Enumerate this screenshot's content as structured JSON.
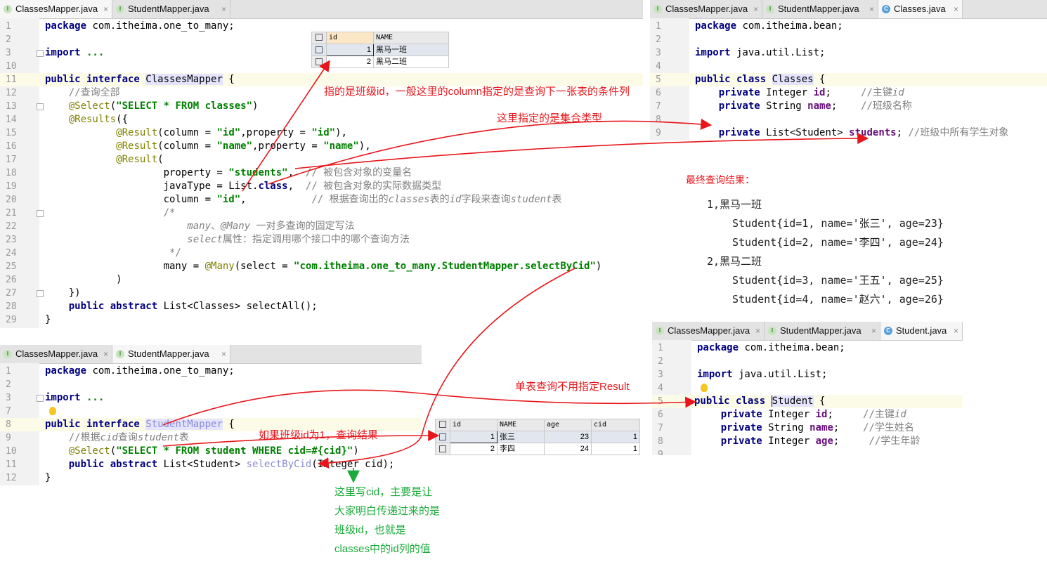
{
  "tabs_tl": [
    {
      "name": "ClassesMapper.java",
      "icon": "I",
      "active": true
    },
    {
      "name": "StudentMapper.java",
      "icon": "I",
      "active": false
    }
  ],
  "tabs_tr": [
    {
      "name": "ClassesMapper.java",
      "icon": "I",
      "active": false
    },
    {
      "name": "StudentMapper.java",
      "icon": "I",
      "active": false
    },
    {
      "name": "Classes.java",
      "icon": "C",
      "active": true
    }
  ],
  "tabs_bl": [
    {
      "name": "ClassesMapper.java",
      "icon": "I",
      "active": false
    },
    {
      "name": "StudentMapper.java",
      "icon": "I",
      "active": true
    }
  ],
  "tabs_br": [
    {
      "name": "ClassesMapper.java",
      "icon": "I",
      "active": false
    },
    {
      "name": "StudentMapper.java",
      "icon": "I",
      "active": false
    },
    {
      "name": "Student.java",
      "icon": "C",
      "active": true
    }
  ],
  "close_glyph": "×",
  "classes_mapper": {
    "numbers": [
      "1",
      "2",
      "3",
      "10",
      "11",
      "12",
      "13",
      "14",
      "15",
      "16",
      "17",
      "18",
      "19",
      "20",
      "21",
      "22",
      "23",
      "24",
      "25",
      "26",
      "27",
      "28",
      "29"
    ],
    "pkg_kw": "package",
    "pkg": " com.itheima.one_to_many;",
    "import_kw": "import",
    "import_rest": " ...",
    "pub": "public",
    "iface": " interface ",
    "cls": "ClassesMapper",
    "brace": " {",
    "c_all": "//查询全部",
    "select_ann": "@Select",
    "select_open": "(",
    "select_sql": "\"SELECT * FROM classes\"",
    "select_close": ")",
    "results_ann": "@Results",
    "results_open": "({",
    "r1_ann": "@Result",
    "r1_a": "(column = ",
    "r1_s1": "\"id\"",
    "r1_b": ",property = ",
    "r1_s2": "\"id\"",
    "r1_c": "),",
    "r2_ann": "@Result",
    "r2_a": "(column = ",
    "r2_s1": "\"name\"",
    "r2_b": ",property = ",
    "r2_s2": "\"name\"",
    "r2_c": "),",
    "r3_ann": "@Result",
    "r3_a": "(",
    "p_prop": "property = ",
    "p_val": "\"students\"",
    "p_comma": ",  ",
    "p_cm": "// 被包含对象的变量名",
    "j_a": "javaType = List.",
    "j_kw": "class",
    "j_b": ",  ",
    "j_cm": "// 被包含对象的实际数据类型",
    "col_a": "column = ",
    "col_val": "\"id\"",
    "col_b": ",           ",
    "col_cm1": "// 根据查询出的",
    "col_cm2": "classes",
    "col_cm3": "表的",
    "col_cm4": "id",
    "col_cm5": "字段来查询",
    "col_cm6": "student",
    "col_cm7": "表",
    "bc_open": "/*",
    "bc1_i": "many",
    "bc1_n": "、",
    "bc1_i2": "@Many",
    "bc1_rest": " 一对多查询的固定写法",
    "bc2_i": "select",
    "bc2_rest": "属性：指定调用哪个接口中的哪个查询方法",
    "bc_close": " */",
    "many_a": "many = ",
    "many_ann": "@Many",
    "many_b": "(select = ",
    "many_str": "\"com.itheima.one_to_many.StudentMapper.selectByCid\"",
    "many_c": ")",
    "paren_close": ")",
    "close2": "})",
    "abs1": "public abstract",
    "abs_rest": " List<Classes> selectAll();",
    "end": "}"
  },
  "classes_table": {
    "headers": [
      "id",
      "NAME"
    ],
    "rows": [
      [
        "1",
        "黑马一班"
      ],
      [
        "2",
        "黑马二班"
      ]
    ]
  },
  "classes_bean": {
    "numbers": [
      "1",
      "2",
      "3",
      "4",
      "5",
      "6",
      "7",
      "8",
      "9"
    ],
    "pkg_kw": "package",
    "pkg": " com.itheima.bean;",
    "import_kw": "import",
    "import_rest": " java.util.List;",
    "pub": "public class",
    "cls": "Classes",
    "brace": " {",
    "f1_kw": "private",
    "f1_t": " Integer ",
    "f1_n": "id",
    "f1_e": ";     ",
    "f1_c": "//主键",
    "f1_ci": "id",
    "f2_kw": "private",
    "f2_t": " String ",
    "f2_n": "name",
    "f2_e": ";    ",
    "f2_c": "//班级名称",
    "f3_kw": "private",
    "f3_t": " List<Student> ",
    "f3_n": "students",
    "f3_e": "; ",
    "f3_c": "//班级中所有学生对象"
  },
  "student_mapper": {
    "numbers": [
      "1",
      "2",
      "3",
      "7",
      "8",
      "9",
      "10",
      "11",
      "12"
    ],
    "pkg_kw": "package",
    "pkg": " com.itheima.one_to_many;",
    "import_kw": "import",
    "import_rest": " ...",
    "pub": "public",
    "iface": " interface ",
    "cls": "StudentMapper",
    "brace": " {",
    "c1": "//根据",
    "c2": "cid",
    "c3": "查询",
    "c4": "student",
    "c5": "表",
    "sel_ann": "@Select",
    "sel_open": "(",
    "sel_sql": "\"SELECT * FROM student WHERE cid=#{cid}\"",
    "sel_close": ")",
    "abs": "public abstract",
    "abs_a": " List<Student> ",
    "abs_m": "selectByCid",
    "abs_b": "(Integer cid);",
    "end": "}"
  },
  "student_table": {
    "headers": [
      "id",
      "NAME",
      "age",
      "cid"
    ],
    "rows": [
      [
        "1",
        "张三",
        "23",
        "1"
      ],
      [
        "2",
        "李四",
        "24",
        "1"
      ]
    ]
  },
  "student_bean": {
    "numbers": [
      "1",
      "2",
      "3",
      "4",
      "5",
      "6",
      "7",
      "8",
      "9"
    ],
    "pkg_kw": "package",
    "pkg": " com.itheima.bean;",
    "import_kw": "import",
    "import_rest": " java.util.List;",
    "pub": "public class",
    "cls": "Student",
    "brace": " {",
    "f1_kw": "private",
    "f1_t": " Integer ",
    "f1_n": "id",
    "f1_e": ";     ",
    "f1_c": "//主键",
    "f1_ci": "id",
    "f2_kw": "private",
    "f2_t": " String ",
    "f2_n": "name",
    "f2_e": ";    ",
    "f2_c": "//学生姓名",
    "f3_kw": "private",
    "f3_t": " Integer ",
    "f3_n": "age",
    "f3_e": ";     ",
    "f3_c": "//学生年龄"
  },
  "notes": {
    "n1": "指的是班级id，一般这里的column指定的是查询下一张表的条件列",
    "n2": "这里指定的是集合类型",
    "n3": "单表查询不用指定Result",
    "n4": "如果班级id为1，查询结果",
    "final_title": "最终查询结果：",
    "g1": "这里写cid，主要是让",
    "g2": "大家明白传递过来的是",
    "g3": "班级id，也就是",
    "g4": "classes中的id列的值"
  },
  "results": {
    "c1": "1,黑马一班",
    "s1": "Student{id=1, name='张三', age=23}",
    "s2": "Student{id=2, name='李四', age=24}",
    "c2": "2,黑马二班",
    "s3": "Student{id=3, name='王五', age=25}",
    "s4": "Student{id=4, name='赵六', age=26}"
  },
  "colors": {
    "annotation": "#e8161b",
    "highlight": "#1aab3a",
    "keyword": "#000080",
    "string": "#008000"
  }
}
